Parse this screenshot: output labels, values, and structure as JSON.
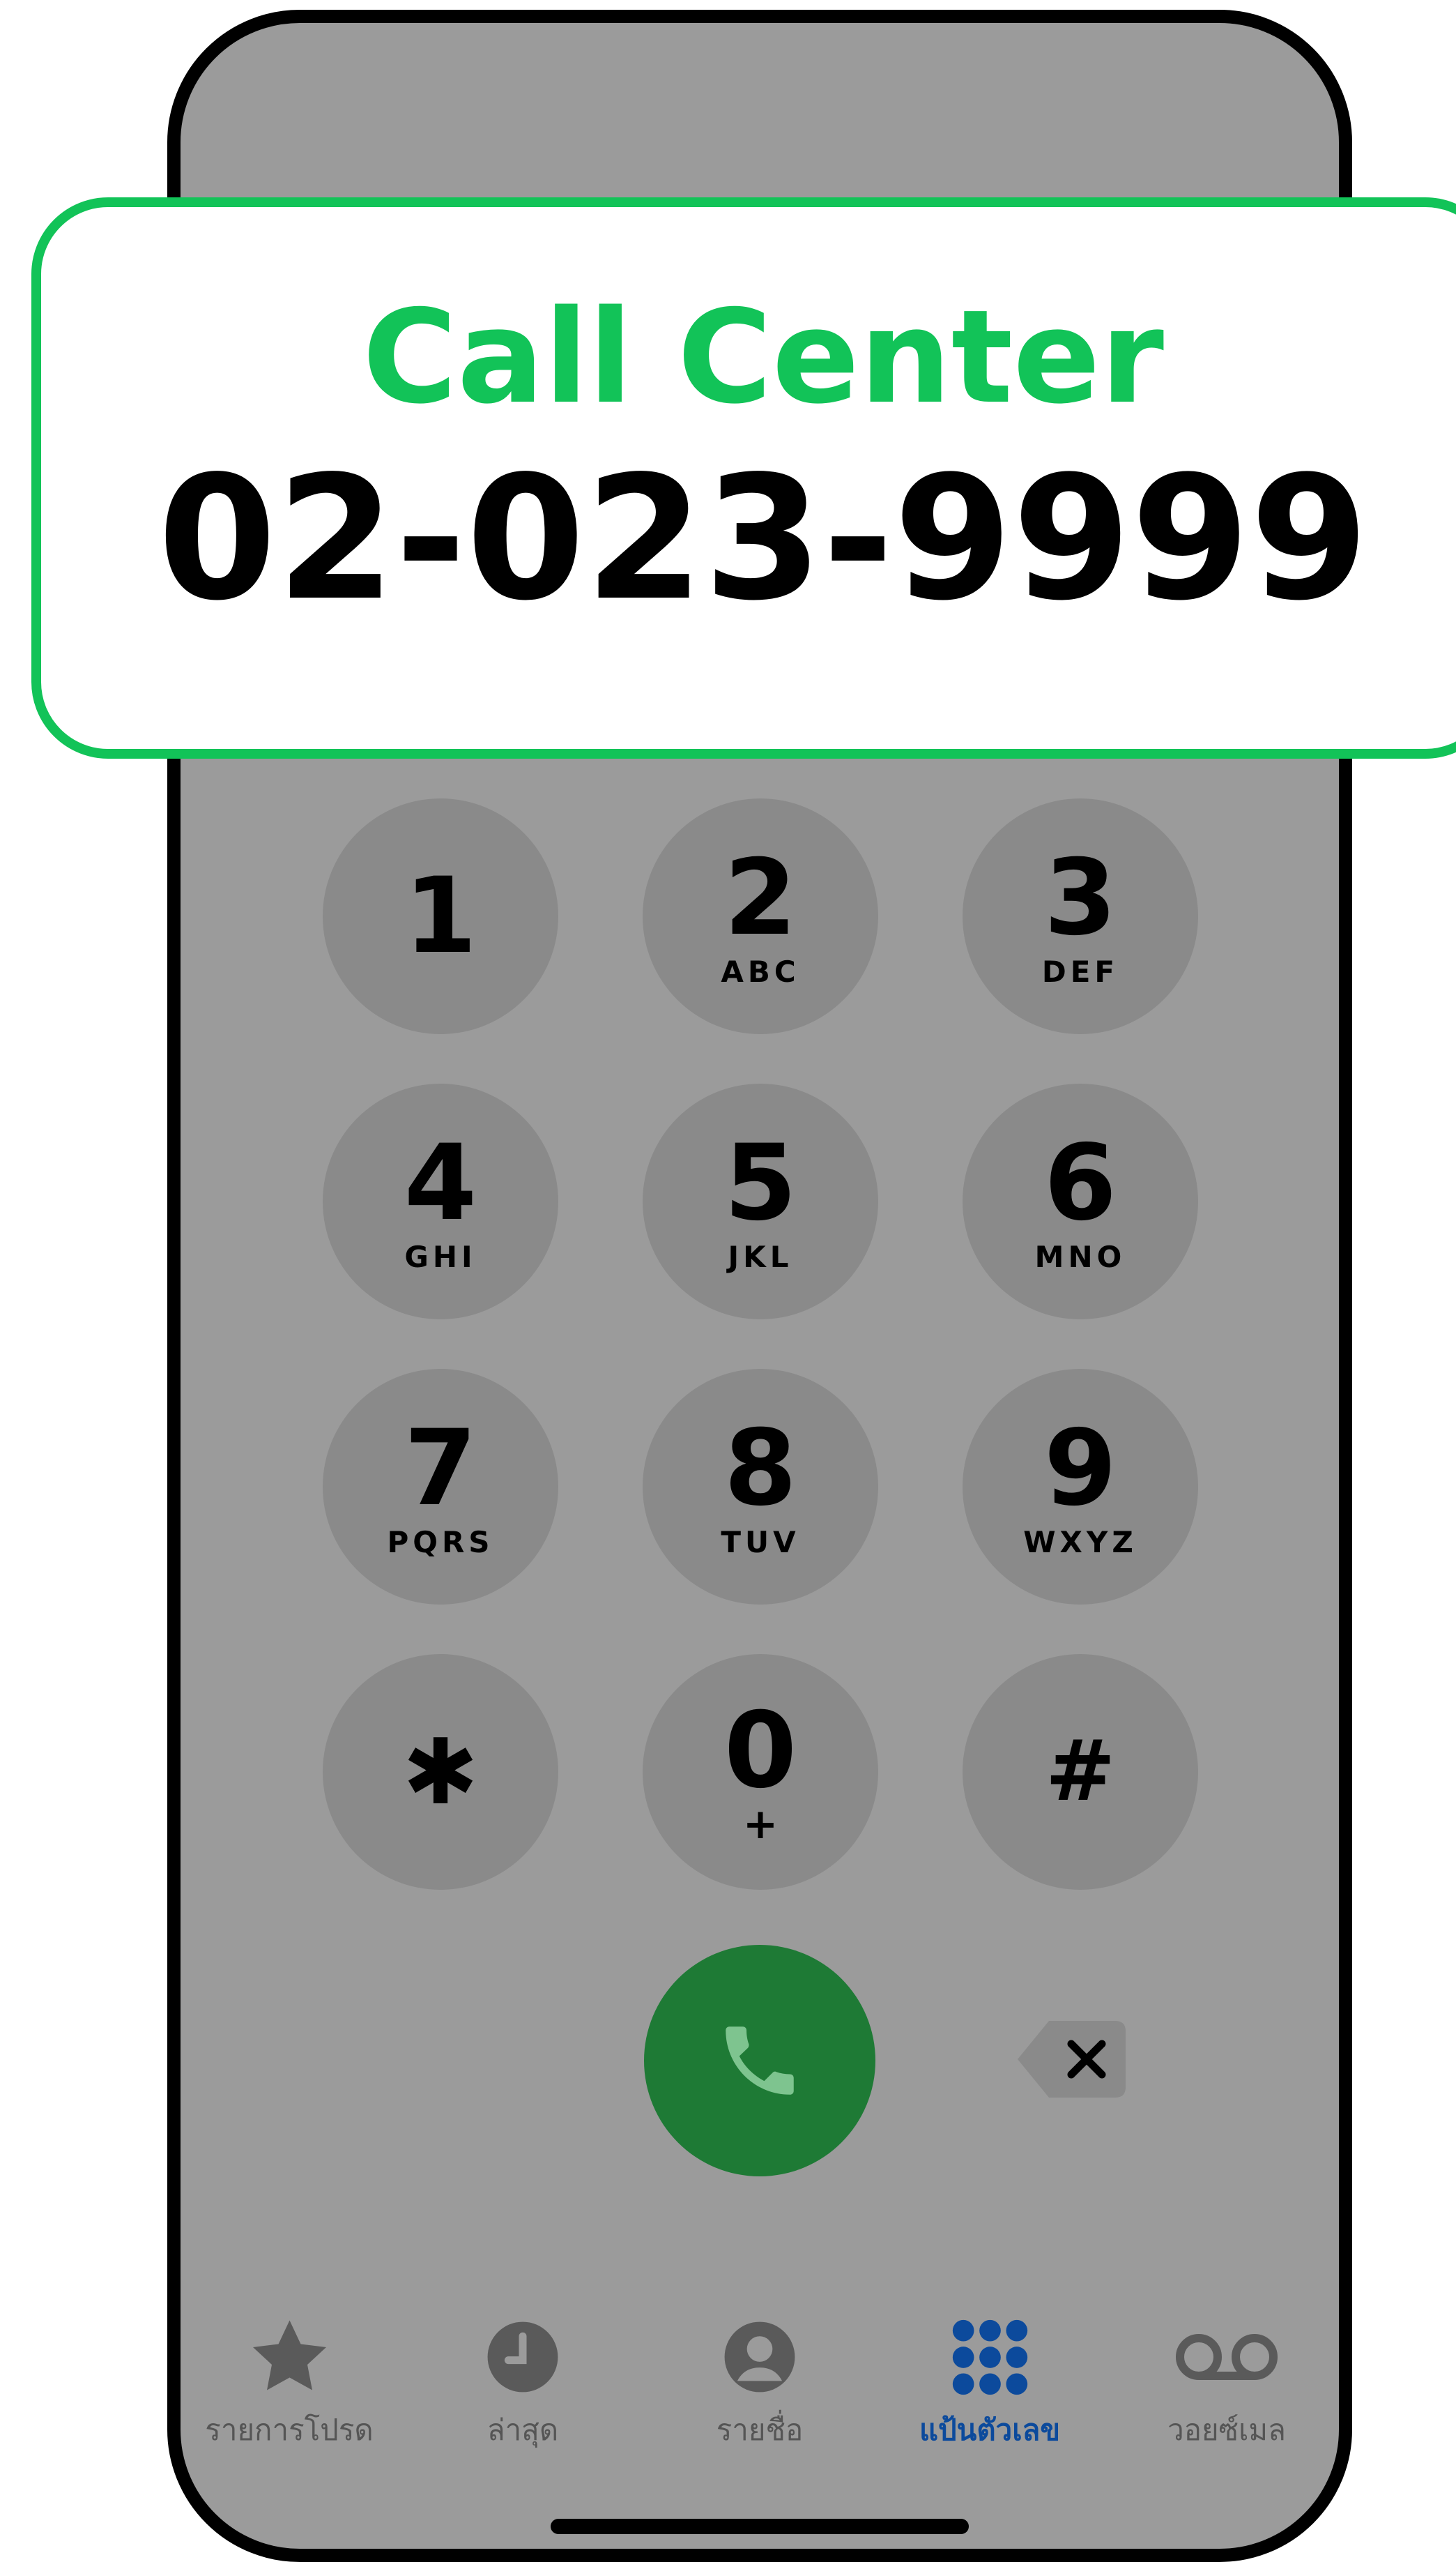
{
  "banner": {
    "title": "Call Center",
    "number": "02-023-9999",
    "accent_color": "#12c358"
  },
  "keypad": {
    "keys": [
      {
        "digit": "1",
        "letters": ""
      },
      {
        "digit": "2",
        "letters": "ABC"
      },
      {
        "digit": "3",
        "letters": "DEF"
      },
      {
        "digit": "4",
        "letters": "GHI"
      },
      {
        "digit": "5",
        "letters": "JKL"
      },
      {
        "digit": "6",
        "letters": "MNO"
      },
      {
        "digit": "7",
        "letters": "PQRS"
      },
      {
        "digit": "8",
        "letters": "TUV"
      },
      {
        "digit": "9",
        "letters": "WXYZ"
      },
      {
        "digit": "✱",
        "letters": ""
      },
      {
        "digit": "0",
        "letters": "+"
      },
      {
        "digit": "#",
        "letters": ""
      }
    ],
    "call_color": "#1e7a35",
    "backspace_icon": "delete-left-icon",
    "call_icon": "phone-icon"
  },
  "tabbar": {
    "active_color": "#0c4a9c",
    "tabs": [
      {
        "label": "รายการโปรด",
        "icon": "star-icon",
        "active": false
      },
      {
        "label": "ล่าสุด",
        "icon": "clock-icon",
        "active": false
      },
      {
        "label": "รายชื่อ",
        "icon": "person-circle-icon",
        "active": false
      },
      {
        "label": "แป้นตัวเลข",
        "icon": "keypad-icon",
        "active": true
      },
      {
        "label": "วอยซ์เมล",
        "icon": "voicemail-icon",
        "active": false
      }
    ]
  }
}
